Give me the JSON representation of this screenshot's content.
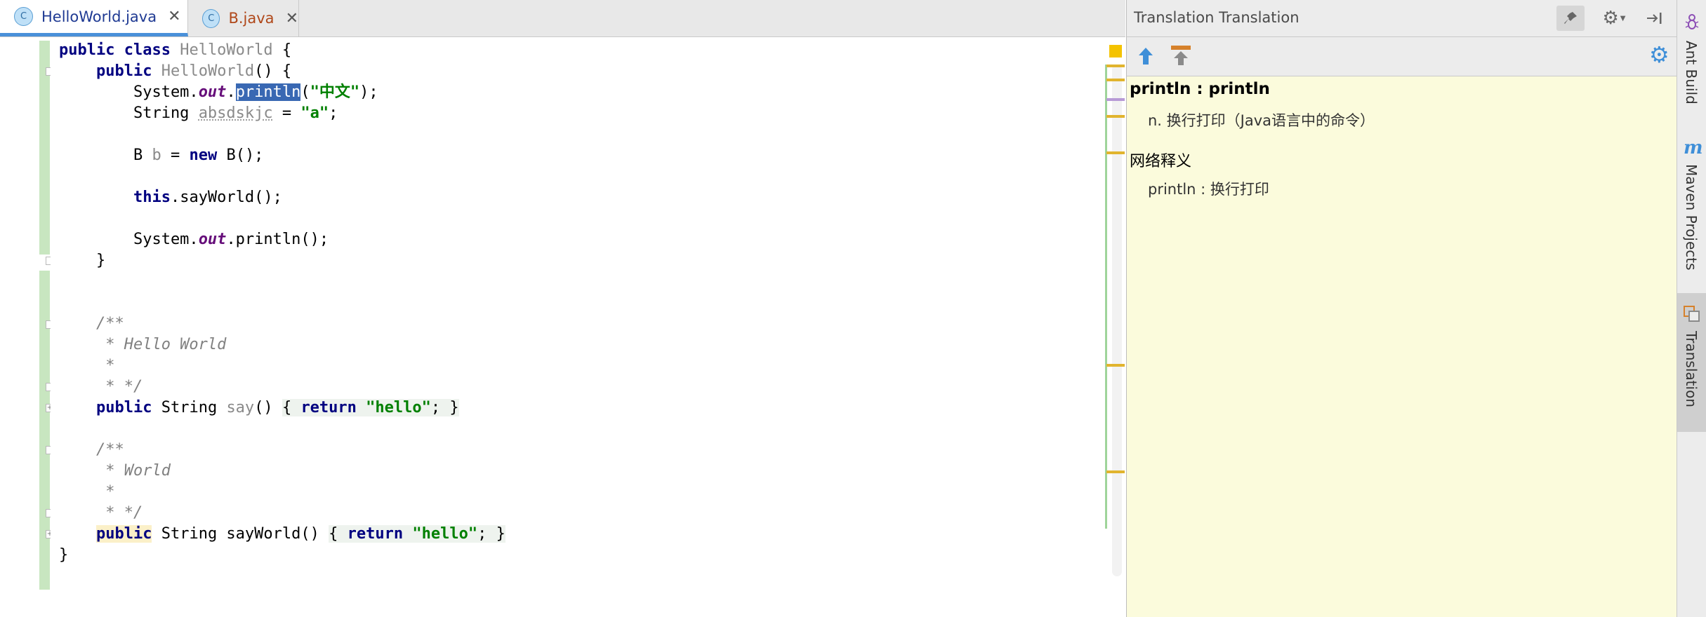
{
  "tabs": [
    {
      "label": "HelloWorld.java",
      "icon": "class-file-icon",
      "active": true
    },
    {
      "label": "B.java",
      "icon": "class-file-icon",
      "active": false
    }
  ],
  "translation": {
    "title": "Translation Translation",
    "word": "println : println",
    "definition": "n. 换行打印（Java语言中的命令）",
    "web_section": "网络释义",
    "web_entry": "println : 换行打印"
  },
  "side_tools": [
    "Ant Build",
    "Maven Projects",
    "Translation"
  ],
  "colors": {
    "accent": "#4a90d9",
    "panel_bg": "#fbfbdc",
    "marker": "#e1b42e"
  }
}
